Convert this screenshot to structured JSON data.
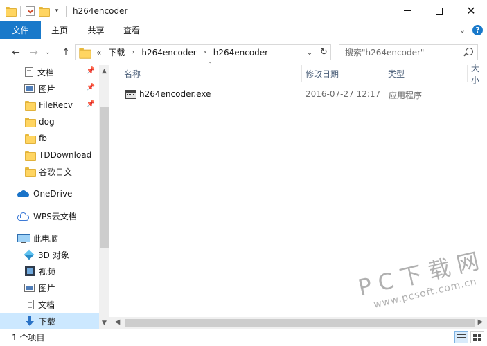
{
  "window": {
    "title": "h264encoder"
  },
  "ribbon": {
    "tabs": [
      "文件",
      "主页",
      "共享",
      "查看"
    ],
    "help": "?"
  },
  "address": {
    "crumbs": [
      "«",
      "下载",
      "h264encoder",
      "h264encoder"
    ],
    "search_placeholder": "搜索\"h264encoder\""
  },
  "nav": {
    "items": [
      {
        "label": "文档",
        "icon": "document-icon",
        "pinned": true
      },
      {
        "label": "图片",
        "icon": "picture-icon",
        "pinned": true
      },
      {
        "label": "FileRecv",
        "icon": "folder-icon",
        "pinned": true
      },
      {
        "label": "dog",
        "icon": "folder-icon"
      },
      {
        "label": "fb",
        "icon": "folder-icon"
      },
      {
        "label": "TDDownload",
        "icon": "folder-icon"
      },
      {
        "label": "谷歌日文",
        "icon": "folder-icon"
      },
      {
        "label": "OneDrive",
        "icon": "cloud-icon"
      },
      {
        "label": "WPS云文档",
        "icon": "wps-cloud-icon"
      },
      {
        "label": "此电脑",
        "icon": "computer-icon"
      },
      {
        "label": "3D 对象",
        "icon": "3d-objects-icon"
      },
      {
        "label": "视频",
        "icon": "video-icon"
      },
      {
        "label": "图片",
        "icon": "picture-icon"
      },
      {
        "label": "文档",
        "icon": "document-icon"
      },
      {
        "label": "下载",
        "icon": "download-icon",
        "selected": true
      }
    ]
  },
  "columns": {
    "name": "名称",
    "date": "修改日期",
    "type": "类型",
    "size": "大小"
  },
  "files": [
    {
      "name": "h264encoder.exe",
      "date": "2016-07-27 12:17",
      "type": "应用程序",
      "icon": "exe-icon"
    }
  ],
  "status": {
    "count": "1 个项目"
  },
  "watermark": {
    "main": "PC下载网",
    "sub": "www.pcsoft.com.cn"
  },
  "colors": {
    "accent": "#1979ca",
    "selected": "#cce8ff",
    "header_text": "#4c607a"
  }
}
